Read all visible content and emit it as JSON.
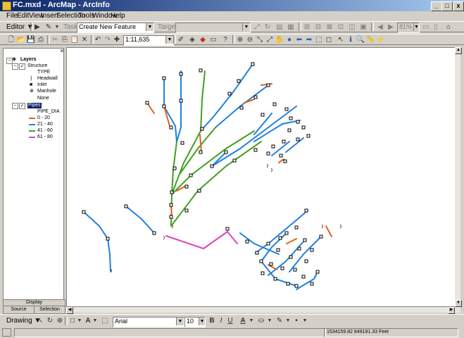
{
  "window": {
    "title": "FC.mxd - ArcMap - ArcInfo",
    "controls": [
      "_",
      "□",
      "x"
    ]
  },
  "menu": [
    "File",
    "Edit",
    "View",
    "Insert",
    "Selection",
    "Tools",
    "Window",
    "Help"
  ],
  "editor_toolbar": {
    "editor_label": "Editor ▼",
    "task_label": "Task:",
    "task_value": "Create New Feature",
    "target_label": "Target:",
    "target_value": "",
    "zoom_value": "81%"
  },
  "standard_toolbar": {
    "scale_value": "1:11,635"
  },
  "toc": {
    "root": "Layers",
    "layers": [
      {
        "name": "Structure",
        "field": "TYPE",
        "classes": [
          {
            "label": "Headwall",
            "symbol": ")"
          },
          {
            "label": "Inlet",
            "symbol": "■"
          },
          {
            "label": "Manhole",
            "symbol": "⊗"
          },
          {
            "label": "None",
            "symbol": ""
          }
        ]
      },
      {
        "name": "Pipes",
        "field": "PIPE_DIA",
        "classes": [
          {
            "label": "0 - 20",
            "color": "#e06020"
          },
          {
            "label": "21 - 40",
            "color": "#2080e0"
          },
          {
            "label": "41 - 60",
            "color": "#40a020"
          },
          {
            "label": "61 - 80",
            "color": "#e040c0"
          }
        ]
      }
    ],
    "tabs": {
      "display": "Display",
      "source": "Source",
      "selection": "Selection"
    }
  },
  "drawing_toolbar": {
    "drawing_label": "Drawing ▼",
    "font_name": "Arial",
    "font_size": "10",
    "bold": "B",
    "italic": "I",
    "underline": "U"
  },
  "status": {
    "coordinates": "1534159.82  849191.33 Feet"
  },
  "colors": {
    "pipe_0_20": "#e06020",
    "pipe_21_40": "#2080e0",
    "pipe_41_60": "#40a020",
    "pipe_61_80": "#e040c0"
  }
}
